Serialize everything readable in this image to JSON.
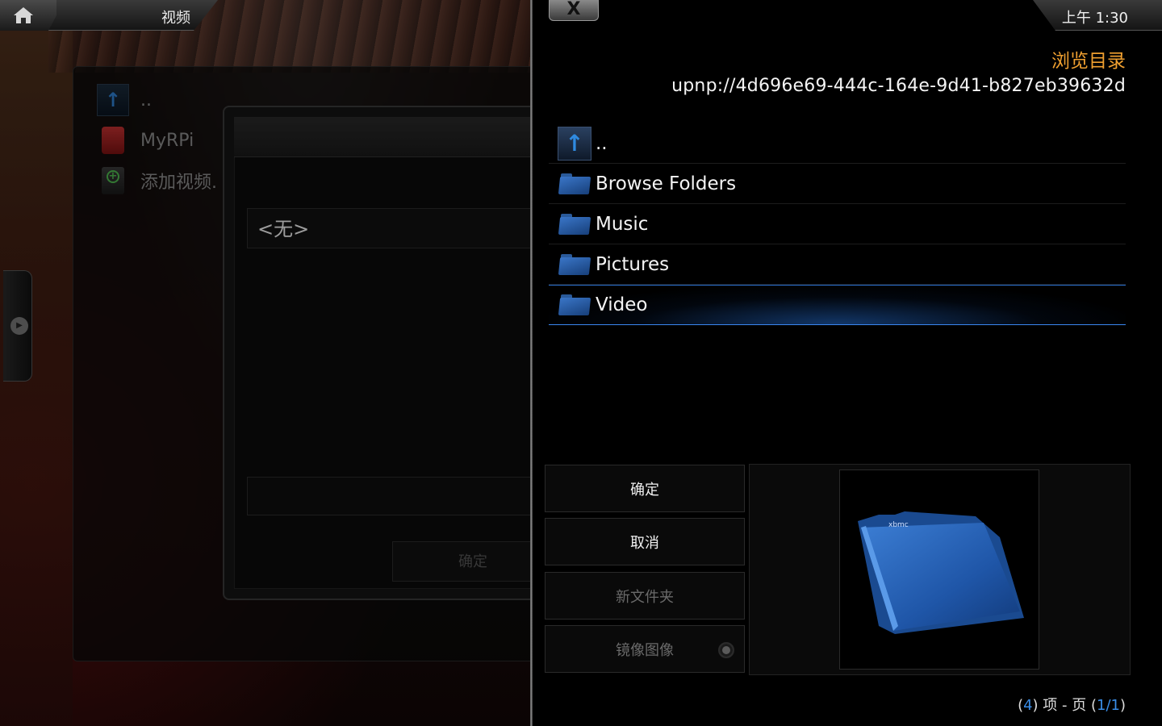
{
  "header": {
    "title": "视频",
    "clock": "上午 1:30"
  },
  "library": {
    "items": [
      {
        "label": ".."
      },
      {
        "label": "MyRPi"
      },
      {
        "label": "添加视频."
      }
    ]
  },
  "source_dialog": {
    "field_value": "<无>",
    "ok_label": "确定"
  },
  "browse": {
    "title": "浏览目录",
    "path": "upnp://4d696e69-444c-164e-9d41-b827eb39632d",
    "close_label": "X",
    "items": [
      {
        "label": "..",
        "icon": "parent-folder-icon"
      },
      {
        "label": "Browse Folders",
        "icon": "folder-icon"
      },
      {
        "label": "Music",
        "icon": "folder-icon"
      },
      {
        "label": "Pictures",
        "icon": "folder-icon"
      },
      {
        "label": "Video",
        "icon": "folder-icon",
        "selected": true
      }
    ],
    "buttons": {
      "ok": "确定",
      "cancel": "取消",
      "new_folder": "新文件夹",
      "mirror_image": "镜像图像"
    },
    "pager": {
      "count": "4",
      "items_label": "项 - 页",
      "page": "1/1"
    }
  },
  "colors": {
    "accent_orange": "#f0a030",
    "accent_blue": "#3a8ee8",
    "selection_blue": "#2a6fd0"
  }
}
